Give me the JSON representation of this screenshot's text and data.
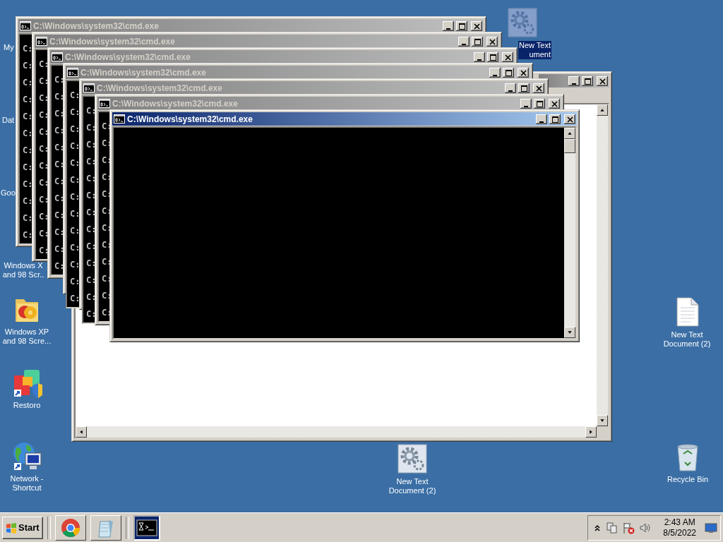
{
  "desktop_icons": [
    {
      "label": "My",
      "kind": "label-only",
      "selected": false
    },
    {
      "label": "Dat",
      "kind": "label-only",
      "selected": false
    },
    {
      "label": "Goo",
      "kind": "label-only",
      "selected": false
    },
    {
      "label": "Windows X\nand 98 Scr..",
      "kind": "label-only",
      "selected": false
    },
    {
      "label": "Windows XP and 98 Scre...",
      "kind": "folder",
      "selected": false
    },
    {
      "label": "Restoro",
      "kind": "restoro",
      "selected": false
    },
    {
      "label": "Network - Shortcut",
      "kind": "network",
      "selected": false
    },
    {
      "label": "New Text\nument",
      "kind": "gear",
      "selected": true
    },
    {
      "label": "New Text Document (2)",
      "kind": "document",
      "selected": false
    },
    {
      "label": "New Text Document (2)",
      "kind": "gear",
      "selected": false
    },
    {
      "label": "Recycle Bin",
      "kind": "recycle",
      "selected": false
    }
  ],
  "windows": [
    {
      "kind": "explorer",
      "active": false
    },
    {
      "kind": "cmd",
      "title": "C:\\Windows\\system32\\cmd.exe",
      "active": false,
      "lines": [
        "C:",
        "C:",
        "C:",
        "C:",
        "C:",
        "C:",
        "C:",
        "C:",
        "C:",
        "C:",
        "C:",
        "C:"
      ]
    },
    {
      "kind": "cmd",
      "title": "C:\\Windows\\system32\\cmd.exe",
      "active": false,
      "lines": [
        "C:",
        "C:",
        "C:",
        "C:",
        "C:",
        "C:",
        "C:",
        "C:",
        "C:",
        "C:",
        "C:",
        "C:"
      ]
    },
    {
      "kind": "cmd",
      "title": "C:\\Windows\\system32\\cmd.exe",
      "active": false,
      "lines": [
        "C:",
        "C:",
        "C:",
        "C:",
        "C:",
        "C:",
        "C:",
        "C:",
        "C:",
        "C:",
        "C:",
        "C:"
      ]
    },
    {
      "kind": "cmd",
      "title": "C:\\Windows\\system32\\cmd.exe",
      "active": false,
      "lines": [
        "C:",
        "C:",
        "C:",
        "C:",
        "C:",
        "C:",
        "C:",
        "C:",
        "C:",
        "C:",
        "C:",
        "C:",
        "C:"
      ]
    },
    {
      "kind": "cmd",
      "title": "C:\\Windows\\system32\\cmd.exe",
      "active": false,
      "lines": [
        "C:",
        "C:",
        "C:",
        "C:",
        "C:",
        "C:",
        "C:",
        "C:",
        "C:",
        "C:",
        "C:",
        "C:",
        "C:"
      ]
    },
    {
      "kind": "cmd",
      "title": "C:\\Windows\\system32\\cmd.exe",
      "active": false,
      "lines": [
        "C:",
        "C:",
        "C:",
        "C:",
        "C:",
        "C:",
        "C:",
        "C:",
        "C:",
        "C:",
        "C:",
        "C:"
      ]
    },
    {
      "kind": "cmd",
      "title": "C:\\Windows\\system32\\cmd.exe",
      "active": true
    }
  ],
  "taskbar": {
    "start_label": "Start",
    "apps": [
      {
        "kind": "chrome",
        "selected": false
      },
      {
        "kind": "notepad",
        "selected": false
      },
      {
        "kind": "cmd",
        "selected": true
      }
    ],
    "clock": {
      "time": "2:43 AM",
      "date": "8/5/2022"
    }
  }
}
